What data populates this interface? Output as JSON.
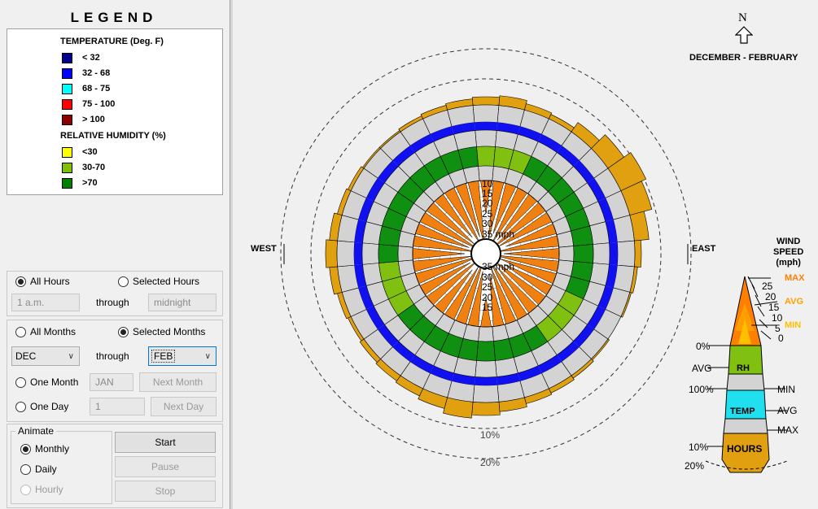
{
  "legend": {
    "title": "LEGEND",
    "temperature_heading": "TEMPERATURE (Deg. F)",
    "temperature": [
      {
        "label": "< 32",
        "color": "#00008b"
      },
      {
        "label": "32  -  68",
        "color": "#0000ff"
      },
      {
        "label": "68  -  75",
        "color": "#00ffff"
      },
      {
        "label": "75  -  100",
        "color": "#ff0000"
      },
      {
        "label": "> 100",
        "color": "#8b0000"
      }
    ],
    "humidity_heading": "RELATIVE HUMIDITY (%)",
    "humidity": [
      {
        "label": "<30",
        "color": "#ffff00"
      },
      {
        "label": "30-70",
        "color": "#80c000"
      },
      {
        "label": ">70",
        "color": "#008000"
      }
    ]
  },
  "hours": {
    "all_label": "All Hours",
    "selected_label": "Selected Hours",
    "from_value": "1 a.m.",
    "through_label": "through",
    "to_value": "midnight"
  },
  "months": {
    "all_label": "All Months",
    "selected_label": "Selected Months",
    "from_value": "DEC",
    "through_label": "through",
    "to_value": "FEB",
    "one_month_label": "One Month",
    "one_month_value": "JAN",
    "next_month_label": "Next Month",
    "one_day_label": "One Day",
    "one_day_value": "1",
    "next_day_label": "Next Day"
  },
  "animate": {
    "group_label": "Animate",
    "monthly_label": "Monthly",
    "daily_label": "Daily",
    "hourly_label": "Hourly",
    "start_label": "Start",
    "pause_label": "Pause",
    "stop_label": "Stop"
  },
  "chart": {
    "north_label": "N",
    "period_label": "DECEMBER - FEBRUARY",
    "west_label": "WEST",
    "east_label": "EAST",
    "speed_rings_upper": [
      "10",
      "15",
      "20",
      "25",
      "30",
      "35 mph"
    ],
    "speed_rings_lower": [
      "35 mph",
      "30",
      "25",
      "20",
      "15"
    ],
    "outer_ring_labels": [
      "10%",
      "20%"
    ],
    "key": {
      "title": "WIND\nSPEED\n(mph)",
      "speed_ticks": [
        "25",
        "20",
        "15",
        "10",
        "5",
        "0"
      ],
      "max_label": "MAX",
      "avg_label": "AVG",
      "min_label": "MIN",
      "rh_pct_label": "0%",
      "rh_avg_label": "AVG",
      "rh_label": "RH",
      "rh_100_label": "100%",
      "rh_min_label": "MIN",
      "temp_label": "TEMP",
      "temp_avg_label": "AVG",
      "temp_max_label": "MAX",
      "hours_label": "HOURS",
      "hours_10": "10%",
      "hours_20": "20%",
      "max_color": "#ff7f00",
      "avg_color": "#ffa000",
      "min_color": "#ffc000"
    }
  },
  "colors": {
    "hours_fill": "#e0a010",
    "temp_fill": "#d3d3d3",
    "temp_blue": "#1010f0",
    "rh_green": "#109010",
    "rh_light": "#80c010",
    "wind_orange": "#f08010"
  }
}
